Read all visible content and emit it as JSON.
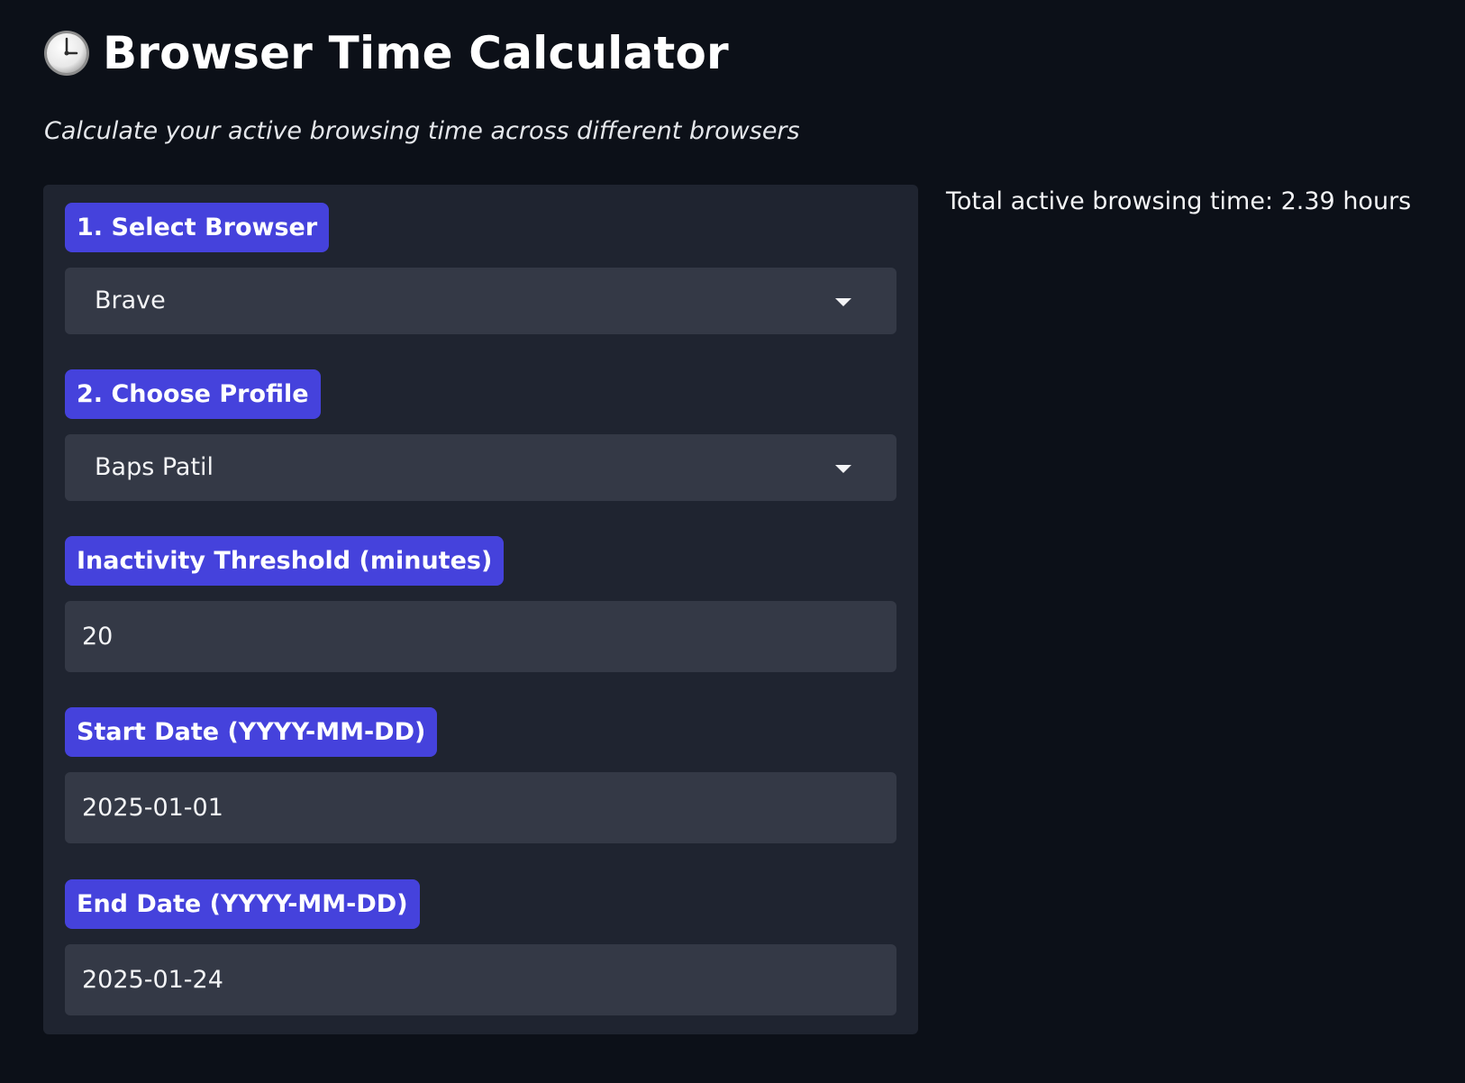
{
  "header": {
    "title": "Browser Time Calculator",
    "icon": "clock-icon",
    "subtitle": "Calculate your active browsing time across different browsers"
  },
  "form": {
    "browser": {
      "label": "1. Select Browser",
      "selected": "Brave"
    },
    "profile": {
      "label": "2. Choose Profile",
      "selected": "Baps Patil"
    },
    "threshold": {
      "label": "Inactivity Threshold (minutes)",
      "value": "20"
    },
    "start_date": {
      "label": "Start Date (YYYY-MM-DD)",
      "value": "2025-01-01"
    },
    "end_date": {
      "label": "End Date (YYYY-MM-DD)",
      "value": "2025-01-24"
    }
  },
  "result": {
    "text": "Total active browsing time: 2.39 hours"
  },
  "colors": {
    "background": "#0c1018",
    "panel": "#1f2430",
    "label_accent": "#4542dc",
    "control": "#343946"
  }
}
